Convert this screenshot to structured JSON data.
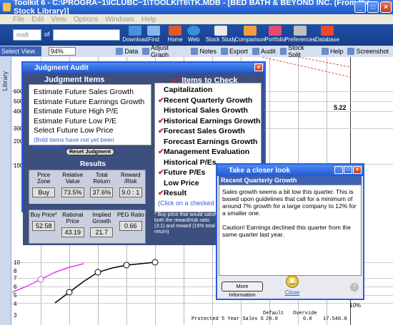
{
  "window": {
    "title": "Toolkit 6 - C:\\PROGRA~1\\ICLUBC~1\\TOOLKIT6\\TK.MDB - [BED BATH & BEYOND INC. (From the Stock Library)]"
  },
  "menu": [
    "File",
    "Edit",
    "View",
    "Options",
    "Windows",
    "Help"
  ],
  "toolbar": {
    "ticker_value": "msft",
    "of_label": "of",
    "buttons": [
      "Download",
      "Find",
      "Home",
      "Web",
      "Stock Study",
      "Comparison",
      "Portfolio",
      "Preferences",
      "Database"
    ]
  },
  "toolbar2": {
    "select_view": "Select View ...",
    "zoom": "94%",
    "items": [
      "Data",
      "Adjust Graph",
      "Notes",
      "Export",
      "Audit",
      "Stock Split",
      "Help",
      "Screenshot"
    ]
  },
  "library_label": "Library",
  "chart": {
    "y_labels": [
      "600",
      "500",
      "400",
      "300",
      "200",
      "100",
      "10",
      "8",
      "7",
      "6",
      "5",
      "4",
      "3"
    ],
    "value_label": "5.22",
    "pct_label": "10%"
  },
  "judgment_audit": {
    "title": "Judgment Audit",
    "left_heading": "Judgment Items",
    "right_heading": "Items to Check",
    "items": [
      "Estimate Future Sales Growth",
      "Estimate Future Earnings Growth",
      "Estimate Future High P/E",
      "Estimate Future Low P/E",
      "Select Future Low Price"
    ],
    "items_note": "(Bold items have not yet been completed.)",
    "reset_label": "Reset Judgment",
    "results_heading": "Results",
    "results_row1": [
      {
        "label": "Price Zone",
        "value": "Buy"
      },
      {
        "label": "Relative Value",
        "value": "73.5%"
      },
      {
        "label": "Total Return",
        "value": "37.6%"
      },
      {
        "label": "Reward /Risk",
        "value": "9.0 : 1"
      }
    ],
    "results_row2": [
      {
        "label": "Buy Price*",
        "value": "52.58"
      },
      {
        "label": "Rational Price",
        "value": "43.19"
      },
      {
        "label": "Implied Growth",
        "value": "21.7"
      },
      {
        "label": "PEG Ratio",
        "value": "0.66"
      }
    ],
    "checks": [
      {
        "label": "Capitalization",
        "checked": false
      },
      {
        "label": "Recent Quarterly Growth",
        "checked": true
      },
      {
        "label": "Historical Sales Growth",
        "checked": false
      },
      {
        "label": "Historical Earnings Growth",
        "checked": true
      },
      {
        "label": "Forecast Sales Growth",
        "checked": true
      },
      {
        "label": "Forecast Earnings Growth",
        "checked": false
      },
      {
        "label": "Management Evaluation",
        "checked": true
      },
      {
        "label": "Historical P/Es",
        "checked": false
      },
      {
        "label": "Future P/Es",
        "checked": true
      },
      {
        "label": "Low Price",
        "checked": false
      },
      {
        "label": "Result",
        "checked": true
      }
    ],
    "checks_link": "(Click on a checked ite",
    "buy_note": "* Buy price that would satisfy both the reward/risk ratio (3:1) and reward (15% total return)"
  },
  "closer_look": {
    "title": "Take a closer look",
    "subtitle": "Recent Quarterly Growth",
    "paragraph1": "Sales growth seems a bit low this quarter.  This is based upon guidelines that call for a minimum of around 7% growth for a large company to 12% for a smaller one.",
    "paragraph2": "Caution!  Earnings declined this quarter from the same quarter last year.",
    "more_info": "More Information",
    "close_label": "Close"
  },
  "bottom": {
    "text1": "Protected 5 Year Sales G",
    "text2": "Default",
    "text3": "Overvide",
    "text4": "20.0",
    "text5": "0.0",
    "text6": "17.540.0"
  }
}
